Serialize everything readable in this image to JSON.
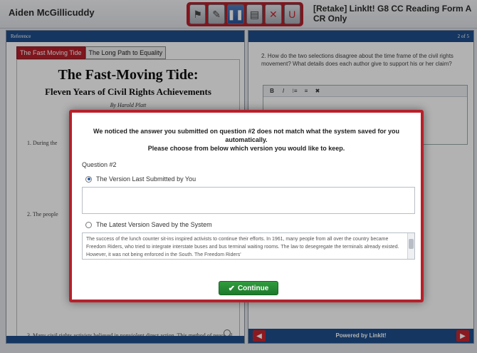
{
  "header": {
    "student_name": "Aiden McGillicuddy",
    "test_title": "[Retake] LinkIt! G8 CC Reading Form A CR Only",
    "tools": [
      {
        "name": "flag-icon",
        "glyph": "⚑"
      },
      {
        "name": "eraser-icon",
        "glyph": "✎"
      },
      {
        "name": "pause-icon",
        "glyph": "❚❚"
      },
      {
        "name": "notepad-icon",
        "glyph": "▤"
      },
      {
        "name": "eliminate-icon",
        "glyph": "✕"
      },
      {
        "name": "magnet-icon",
        "glyph": "U"
      }
    ]
  },
  "left_panel": {
    "header": "Reference",
    "tabs": [
      "The Fast Moving Tide",
      "The Long Path to Equality"
    ],
    "title": "The Fast-Moving Tide:",
    "subtitle": "Fleven Years of Civil Rights Achievements",
    "byline": "By Harold Platt",
    "para1_start": "1.  During the",
    "para2_start": "2.  The people",
    "para3": "3.  Many civil rights activists believed in nonviolent direct action. This method of peaceful civil disobedience took a lot of effort and"
  },
  "right_panel": {
    "page_counter": "2 of 5",
    "question": "2.   How do the two selections disagree about the time frame of the civil rights movement? What details does each author give to support his or her claim?",
    "editor_buttons": [
      "B",
      "I",
      "⁝≡",
      "≡",
      "✖"
    ],
    "footer_text": "Powered by LinkIt!"
  },
  "modal": {
    "message_line1": "We noticed the answer you submitted on question #2 does not match what the system saved for you automatically.",
    "message_line2": "Please choose from below which version you would like to keep.",
    "question_label": "Question #2",
    "option1_label": "The Version Last Submitted by You",
    "option1_selected": true,
    "option1_text": "",
    "option2_label": "The Latest Version Saved by the System",
    "option2_selected": false,
    "option2_text": "The success of the lunch counter sit-ins inspired activists to continue their efforts. In 1961, many people from all over the country became Freedom Riders, who tried to integrate interstate buses and bus terminal waiting rooms. The law to desegregate the terminals already existed. However, it was not being enforced in the South. The Freedom Riders'",
    "continue_label": "Continue"
  },
  "colors": {
    "accent_red": "#b8202a",
    "panel_blue": "#1f4e8c",
    "continue_green": "#2f9c3e"
  }
}
